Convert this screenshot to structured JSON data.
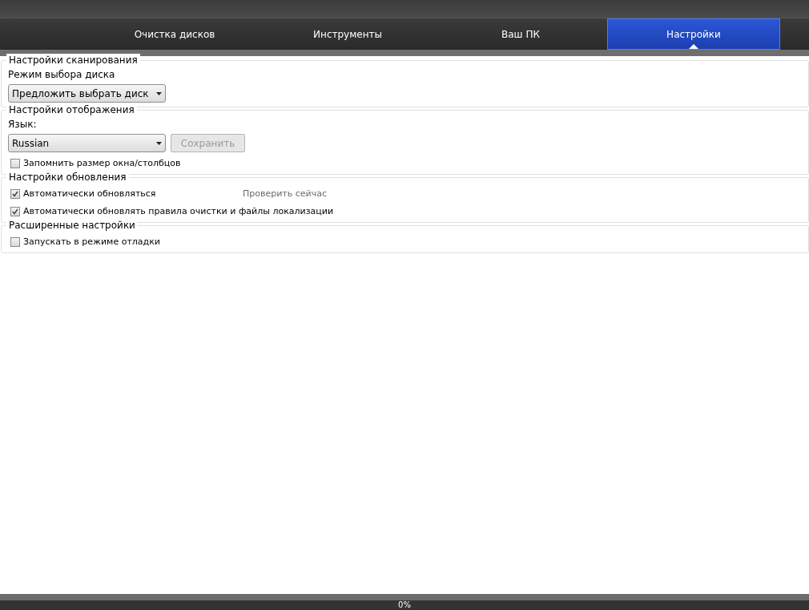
{
  "tabs": [
    {
      "label": "Очистка дисков",
      "selected": false
    },
    {
      "label": "Инструменты",
      "selected": false
    },
    {
      "label": "Ваш ПК",
      "selected": false
    },
    {
      "label": "Настройки",
      "selected": true
    }
  ],
  "sections": [
    {
      "title": "Настройки сканирования",
      "items": [
        {
          "kind": "label",
          "text": "Режим выбора диска"
        },
        {
          "kind": "dropdown",
          "value": "Предложить выбрать диск"
        }
      ]
    },
    {
      "title": "Настройки отображения",
      "items": [
        {
          "kind": "label",
          "text": "Язык:"
        },
        {
          "kind": "dropdown",
          "value": "Russian",
          "button": {
            "label": "Сохранить",
            "disabled": true
          }
        },
        {
          "kind": "checkbox",
          "label": "Запомнить размер окна/столбцов",
          "checked": false
        }
      ]
    },
    {
      "title": "Настройки обновления",
      "items": [
        {
          "kind": "checkbox",
          "label": "Автоматически обновляться",
          "checked": true,
          "link": "Проверить сейчас"
        },
        {
          "kind": "checkbox",
          "label": "Автоматически обновлять правила очистки и файлы локализации",
          "checked": true
        }
      ]
    },
    {
      "title": "Расширенные настройки",
      "items": [
        {
          "kind": "checkbox",
          "label": "Запускать в режиме отладки",
          "checked": false
        }
      ]
    }
  ],
  "status_bar": {
    "progress_text": "0%"
  }
}
